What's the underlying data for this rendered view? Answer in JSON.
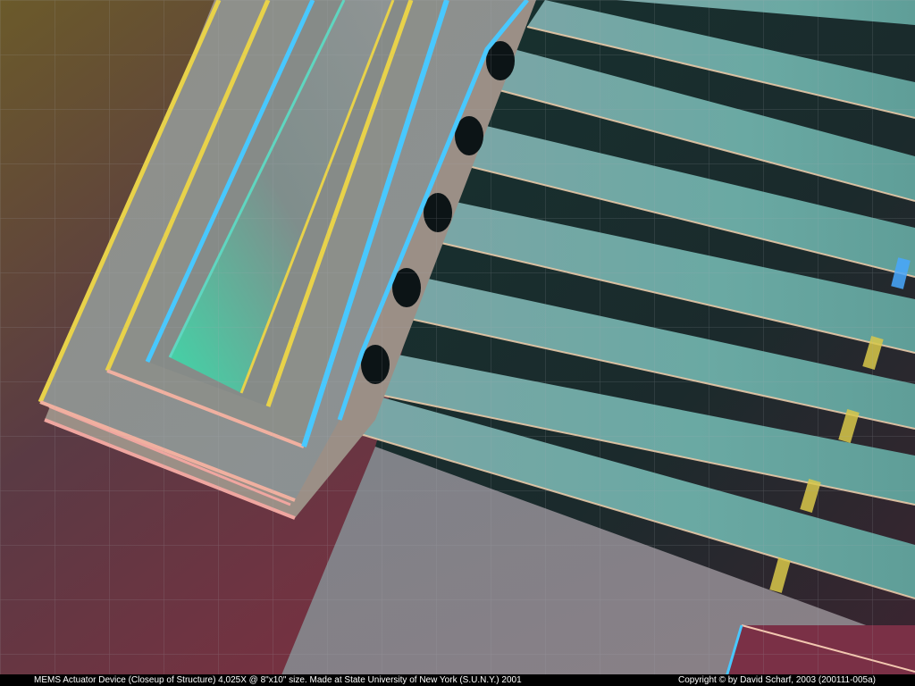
{
  "caption": {
    "left": "MEMS Actuator Device (Closeup of Structure) 4,025X @ 8\"x10\" size.  Made at State University of New York (S.U.N.Y.) 2001",
    "right": "Copyright © by David Scharf, 2003   (200111-005a)"
  },
  "colors": {
    "background_warm": "#8a3a44",
    "background_dark": "#1e2a2c",
    "structure_gray": "#8f9598",
    "finger_teal": "#6fa7a2",
    "edge_cyan": "#48c8ff",
    "edge_yellow": "#e8d24a",
    "grid_line": "#9aa0a8"
  }
}
